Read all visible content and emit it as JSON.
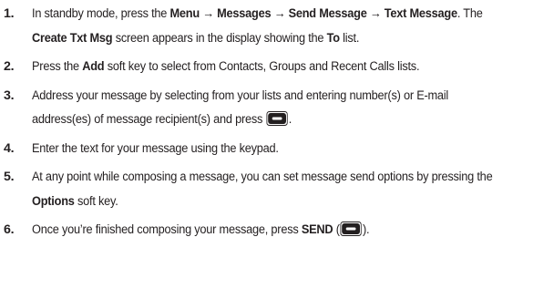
{
  "steps": [
    {
      "num": "1.",
      "parts": [
        "In standby mode, press the ",
        "Menu → Messages → Send Message → Text Message",
        ". The ",
        "Create Txt Msg",
        " screen appears in the display showing the ",
        "To",
        " list."
      ]
    },
    {
      "num": "2.",
      "parts": [
        "Press the ",
        "Add",
        " soft key to select from Contacts, Groups and Recent Calls lists."
      ]
    },
    {
      "num": "3.",
      "parts": [
        "Address your message by selecting from your lists and entering number(s) or E-mail address(es) of message recipient(s) and press ",
        "."
      ],
      "icon": "ok-key-icon"
    },
    {
      "num": "4.",
      "parts": [
        "Enter the text for your message using the keypad."
      ]
    },
    {
      "num": "5.",
      "parts": [
        "At any point while composing a message, you can set message send options by pressing the ",
        "Options",
        " soft key."
      ]
    },
    {
      "num": "6.",
      "parts": [
        "Once you’re finished composing your message, press ",
        "SEND",
        " (",
        ")."
      ],
      "icon": "send-key-icon"
    }
  ],
  "colors": {
    "text": "#231f20",
    "key_fill": "#231f20",
    "key_inner": "#ffffff"
  }
}
